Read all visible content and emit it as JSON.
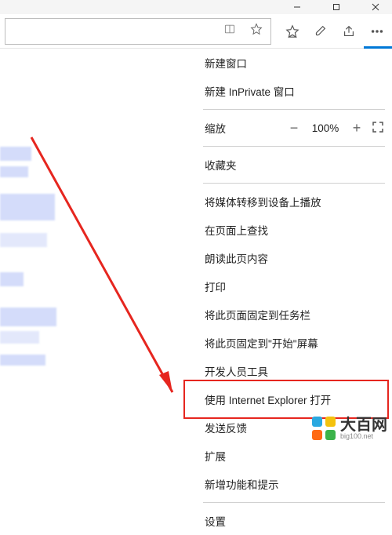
{
  "menu": {
    "new_window": "新建窗口",
    "new_inprivate": "新建 InPrivate 窗口",
    "zoom_label": "缩放",
    "zoom_value": "100%",
    "favorites": "收藏夹",
    "cast": "将媒体转移到设备上播放",
    "find": "在页面上查找",
    "read_aloud": "朗读此页内容",
    "print": "打印",
    "pin_taskbar": "将此页面固定到任务栏",
    "pin_start": "将此页固定到\"开始\"屏幕",
    "devtools": "开发人员工具",
    "open_ie": "使用 Internet Explorer 打开",
    "feedback": "发送反馈",
    "extensions": "扩展",
    "whats_new": "新增功能和提示",
    "settings": "设置"
  },
  "watermark": {
    "title": "大百网",
    "sub": "big100.net"
  }
}
